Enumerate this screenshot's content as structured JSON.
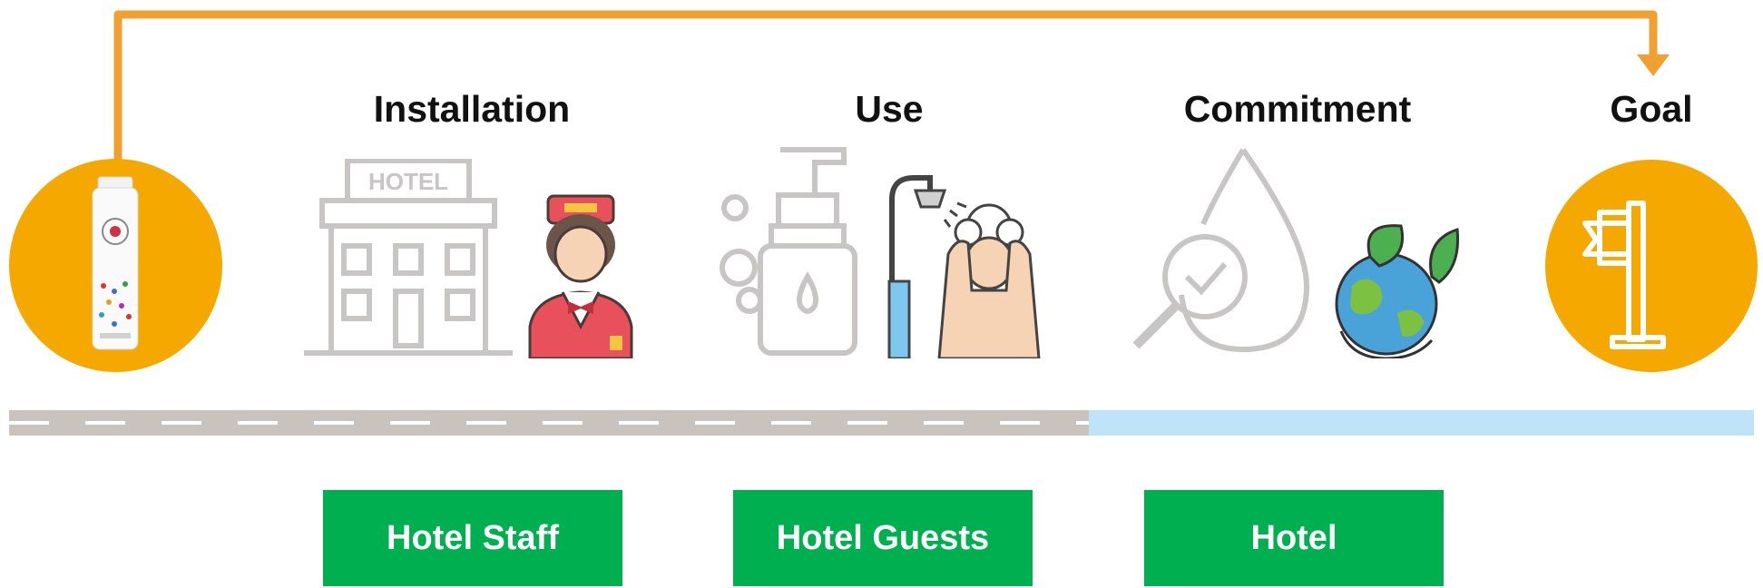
{
  "stages": [
    {
      "title": "Installation",
      "actor": "Hotel Staff"
    },
    {
      "title": "Use",
      "actor": "Hotel Guests"
    },
    {
      "title": "Commitment",
      "actor": "Hotel"
    }
  ],
  "goal": {
    "title": "Goal"
  },
  "colors": {
    "orange": "#f5a800",
    "arrow": "#f0a030",
    "green": "#00b050",
    "road_gray": "#c9c3c0",
    "road_blue": "#bfe3f8",
    "icon_gray": "#c8c6c4"
  },
  "icons": [
    "product-bottle-icon",
    "hotel-building-icon",
    "bellboy-icon",
    "soap-dispenser-icon",
    "shower-person-icon",
    "water-drop-search-icon",
    "earth-leaves-icon",
    "goal-flag-icon"
  ]
}
